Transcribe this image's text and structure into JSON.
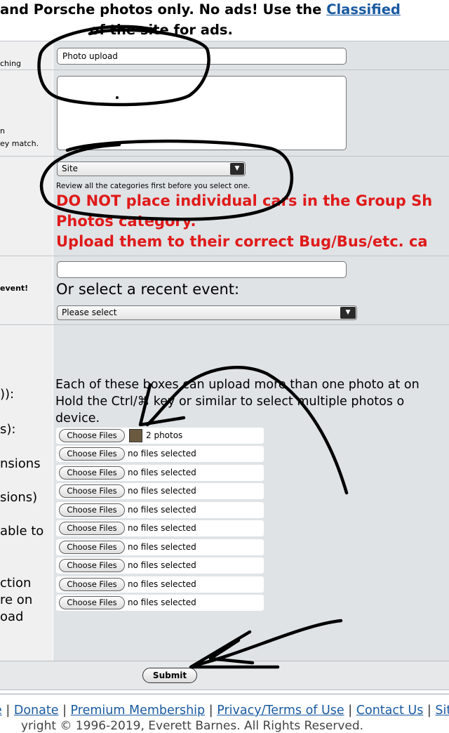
{
  "header": {
    "line1_prefix": "and Porsche photos only. No ads! Use the ",
    "line1_link": "Classified",
    "line2": "of the site for ads."
  },
  "rows": {
    "title": {
      "label": "ching",
      "value": "Photo upload"
    },
    "description": {
      "label_line1": "n",
      "label_line2": "ey match.",
      "value": ""
    },
    "category": {
      "selected": "Site",
      "hint": "Review all the categories first before you select one.",
      "warning_line1": "DO NOT place individual cars in the Group Sh",
      "warning_line2": "Photos category.",
      "warning_line3": "Upload them to their correct Bug/Bus/etc. ca"
    },
    "event": {
      "label": "event!",
      "value": "",
      "recent_prompt": "Or select a recent event:",
      "recent_selected": "Please select"
    },
    "files": {
      "labels": [
        ")):",
        "s):",
        "nsions",
        "sions)",
        " able to",
        "ction",
        "re on",
        "oad"
      ],
      "info_line1": "Each of these boxes can upload more than one photo at on",
      "info_line2": "Hold the Ctrl/⌘ key or similar to select multiple photos o",
      "info_line3": "device.",
      "button_label": "Choose Files",
      "first_status": "2 photos",
      "empty_status": "no files selected"
    }
  },
  "submit_label": "Submit",
  "footer": {
    "links": [
      "e",
      "Donate",
      "Premium Membership",
      "Privacy/Terms of Use",
      "Contact Us",
      "Site"
    ],
    "separator": "|",
    "copyright": "yright © 1996-2019, Everett Barnes. All Rights Reserved."
  }
}
